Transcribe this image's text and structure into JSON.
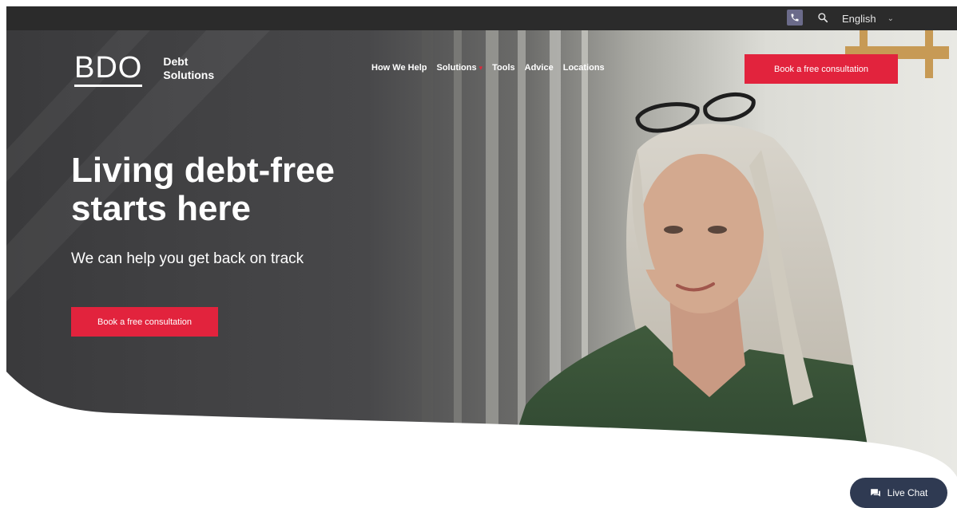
{
  "topbar": {
    "language": "English",
    "phone_icon": "phone-icon",
    "search_icon": "search-icon",
    "chevron_icon": "chevron-down-icon"
  },
  "brand": {
    "name": "BDO",
    "subtitle_line1": "Debt",
    "subtitle_line2": "Solutions"
  },
  "nav": {
    "items": [
      "How We Help",
      "Solutions",
      "Tools",
      "Advice",
      "Locations"
    ]
  },
  "hero": {
    "cta_top_label": "Book a free consultation",
    "headline_line1": "Living debt-free",
    "headline_line2": "starts here",
    "subheadline": "We can help you get back on track",
    "cta_label": "Book a free consultation"
  },
  "chat": {
    "label": "Live Chat",
    "icon": "chat-icon"
  },
  "colors": {
    "accent": "#e2233d",
    "topbar": "#2b2b2b",
    "chat": "#2f3a52"
  }
}
